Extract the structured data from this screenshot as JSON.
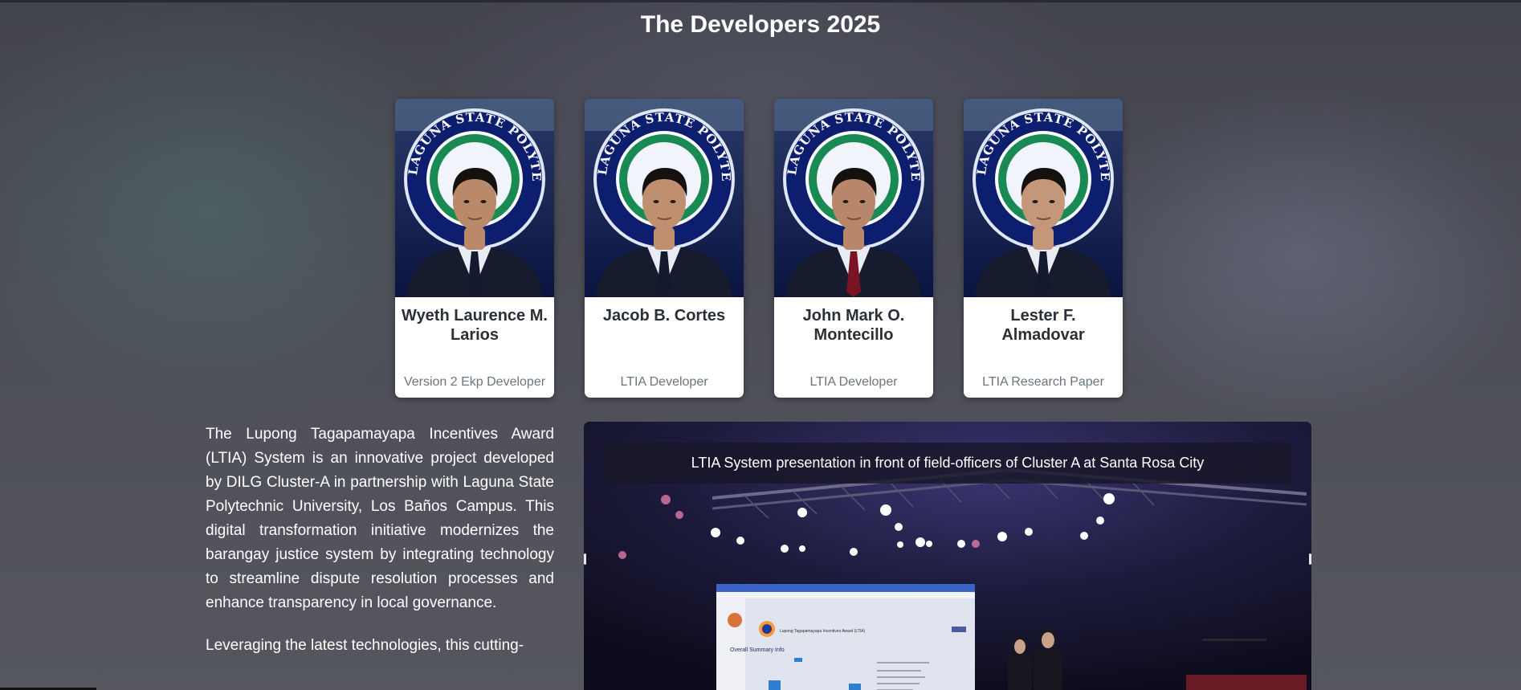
{
  "page": {
    "title": "The Developers 2025"
  },
  "developers": [
    {
      "name": "Wyeth Laurence M. Larios",
      "role": "Version 2 Ekp Developer",
      "tie_color": "#141a2e"
    },
    {
      "name": "Jacob B. Cortes",
      "role": "LTIA Developer",
      "tie_color": "#141a2e"
    },
    {
      "name": "John Mark O. Montecillo",
      "role": "LTIA Developer",
      "tie_color": "#7a1424"
    },
    {
      "name": "Lester F. Almadovar",
      "role": "LTIA Research Paper",
      "tie_color": "#141a2e"
    }
  ],
  "seal_text": "LAGUNA STATE POLYTECHNIC UNIVERSITY",
  "about": {
    "paragraphs": [
      "The Lupong Tagapamayapa Incentives Award (LTIA) System is an innovative project developed by DILG Cluster-A in partnership with Laguna State Polytechnic University, Los Baños Campus. This digital transformation initiative modernizes the barangay justice system by integrating technology to streamline dispute resolution processes and enhance transparency in local governance.",
      "Leveraging the latest technologies, this cutting-"
    ]
  },
  "carousel": {
    "caption": "LTIA System presentation in front of field-officers of Cluster A at Santa Rosa City",
    "screen": {
      "header": "Lupong Tagapamayapa Incentives Award (LTIA)",
      "summary": "Overall Summary Info"
    }
  },
  "colors": {
    "card_bg": "#ffffff",
    "name_text": "#2b2f36",
    "role_text": "#6c757d",
    "seal_blue": "#0e1e6e"
  }
}
